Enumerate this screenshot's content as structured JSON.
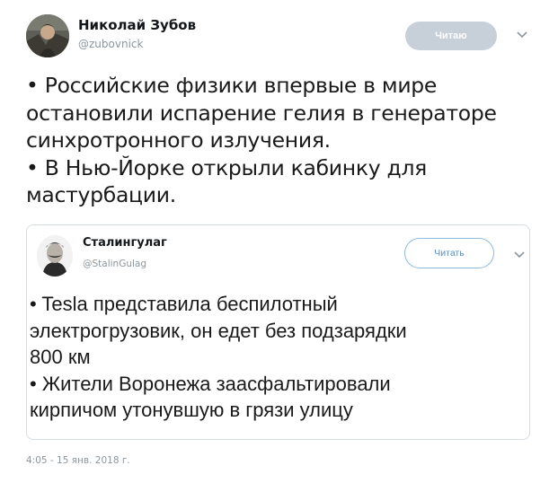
{
  "author": {
    "name": "Николай Зубов",
    "handle": "@zubovnick",
    "follow_label": "Читаю"
  },
  "tweet": {
    "lines": [
      "• Российские физики впервые в мире",
      "остановили испарение гелия в генераторе",
      "синхротронного излучения.",
      "• В Нью-Йорке открыли кабинку для",
      "мастурбации."
    ]
  },
  "quoted": {
    "name": "Сталингулаг",
    "handle": "@StalinGulag",
    "follow_label": "Читать",
    "lines": [
      "• Tesla представила беспилотный",
      "электрогрузовик, он едет без подзарядки",
      "800 км",
      "• Жители Воронежа заасфальтировали",
      "кирпичом утонувшую в грязи улицу"
    ]
  },
  "timestamp": "4:05 - 15 янв. 2018 г.",
  "icons": {
    "avatar": "author-avatar",
    "quoted_avatar": "stalin-portrait-avatar",
    "menu": "chevron-down-icon"
  },
  "colors": {
    "follow_grey": "#c7d0d8",
    "follow_outline": "#8fb9dc",
    "muted_text": "#8c969e",
    "card_border": "#d6dde3"
  }
}
